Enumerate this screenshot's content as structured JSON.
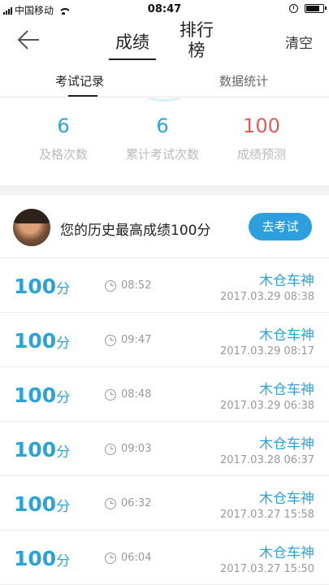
{
  "status_bar": {
    "carrier": "中国移动",
    "time": "08:47"
  },
  "nav": {
    "tab_score": "成绩",
    "tab_rank": "排行榜",
    "clear": "清空"
  },
  "subtabs": {
    "records": "考试记录",
    "statistics": "数据统计"
  },
  "stats": [
    {
      "value": "6",
      "label": "及格次数"
    },
    {
      "value": "6",
      "label": "累计考试次数"
    },
    {
      "value": "100",
      "label": "成绩预测"
    }
  ],
  "best": {
    "text": "您的历史最高成绩100分",
    "button": "去考试"
  },
  "records": [
    {
      "score": "100",
      "unit": "分",
      "duration": "08:52",
      "name": "木仓车神",
      "date": "2017.03.29  08:38"
    },
    {
      "score": "100",
      "unit": "分",
      "duration": "09:47",
      "name": "木仓车神",
      "date": "2017.03.29  08:17"
    },
    {
      "score": "100",
      "unit": "分",
      "duration": "08:48",
      "name": "木仓车神",
      "date": "2017.03.29  06:38"
    },
    {
      "score": "100",
      "unit": "分",
      "duration": "09:03",
      "name": "木仓车神",
      "date": "2017.03.28  06:37"
    },
    {
      "score": "100",
      "unit": "分",
      "duration": "06:32",
      "name": "木仓车神",
      "date": "2017.03.27  15:58"
    },
    {
      "score": "100",
      "unit": "分",
      "duration": "06:04",
      "name": "木仓车神",
      "date": "2017.03.27  15:50"
    }
  ],
  "colors": {
    "accent": "#2aa4d8",
    "button": "#2d9fdd",
    "prediction": "#e05a5a"
  },
  "icons": {
    "back": "arrow-left-icon",
    "duration": "clock-icon"
  }
}
